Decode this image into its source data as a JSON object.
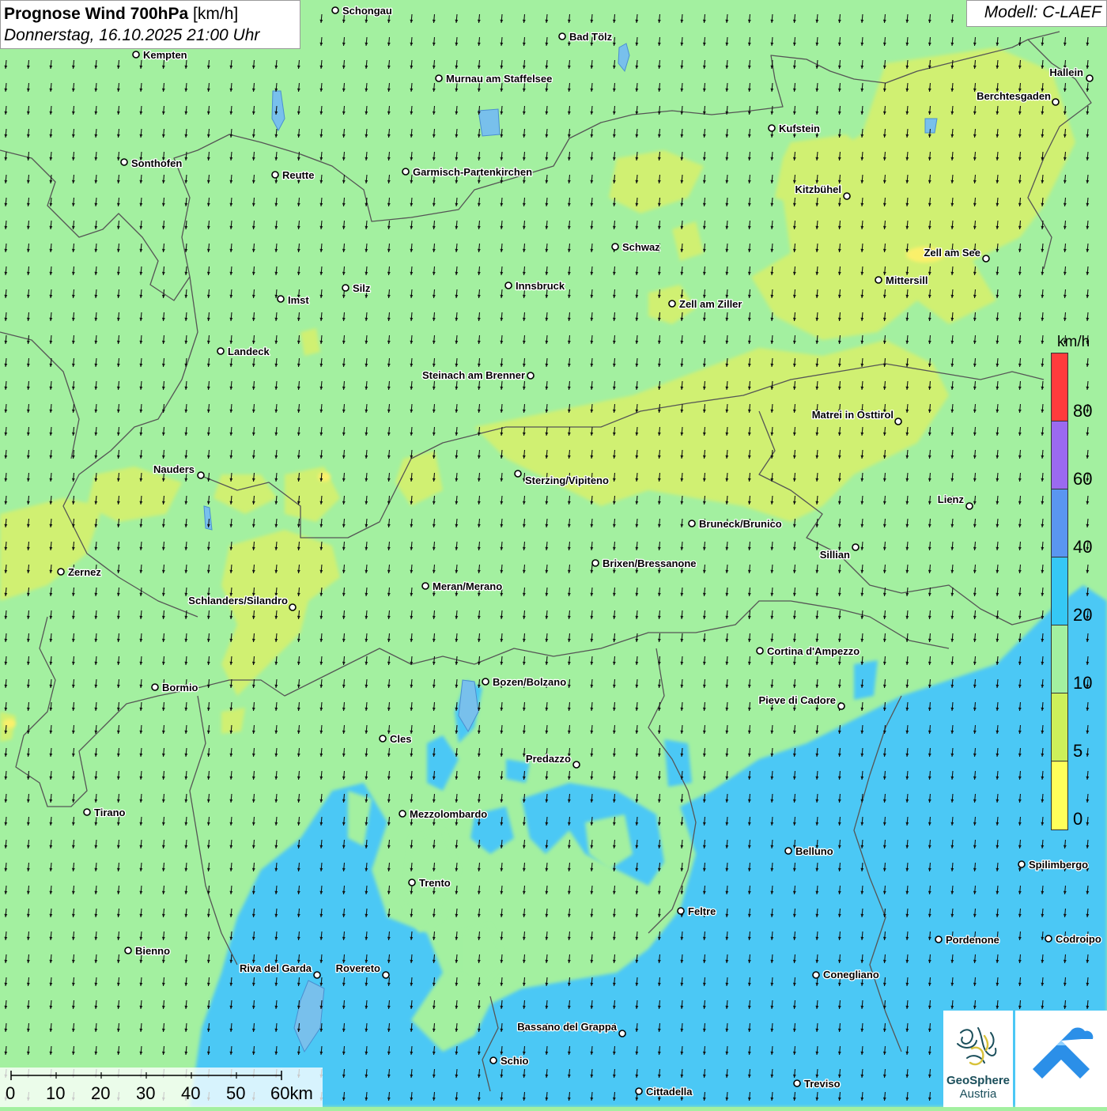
{
  "header": {
    "title": "Prognose Wind 700hPa",
    "unit": "[km/h]",
    "datetime": "Donnerstag, 16.10.2025 21:00 Uhr"
  },
  "model_label": "Modell: C-LAEF",
  "legend": {
    "unit": "km/h",
    "ticks": [
      "80",
      "60",
      "40",
      "20",
      "10",
      "5",
      "0"
    ],
    "classes": [
      {
        "from": 0,
        "to": 5,
        "color": "#ffff5a"
      },
      {
        "from": 5,
        "to": 10,
        "color": "#cdf05a"
      },
      {
        "from": 10,
        "to": 20,
        "color": "#a3f0a0"
      },
      {
        "from": 20,
        "to": 40,
        "color": "#35c8f5"
      },
      {
        "from": 40,
        "to": 60,
        "color": "#5a96f0"
      },
      {
        "from": 60,
        "to": 80,
        "color": "#9b6af0"
      },
      {
        "from": 80,
        "to": 100,
        "color": "#ff3c3c"
      }
    ]
  },
  "scalebar": {
    "labels": [
      "0",
      "10",
      "20",
      "30",
      "40",
      "50",
      "60km"
    ]
  },
  "logos": {
    "geosphere_name": "GeoSphere",
    "geosphere_sub": "Austria"
  },
  "wind": {
    "direction": "north-northeast",
    "arrow_pointing": "south-southwest",
    "dominant_class_km_h": "10-20",
    "strong_class_km_h": "20-40 (south-east)",
    "weak_class_km_h": "5-10 (north-east)"
  },
  "cities": [
    {
      "name": "Schongau"
    },
    {
      "name": "Bad Tölz"
    },
    {
      "name": "Kempten"
    },
    {
      "name": "Murnau am Staffelsee"
    },
    {
      "name": "Hallein"
    },
    {
      "name": "Berchtesgaden"
    },
    {
      "name": "Kufstein"
    },
    {
      "name": "Sonthofen"
    },
    {
      "name": "Reutte"
    },
    {
      "name": "Garmisch-Partenkirchen"
    },
    {
      "name": "Kitzbühel"
    },
    {
      "name": "Schwaz"
    },
    {
      "name": "Zell am See"
    },
    {
      "name": "Innsbruck"
    },
    {
      "name": "Silz"
    },
    {
      "name": "Imst"
    },
    {
      "name": "Mittersill"
    },
    {
      "name": "Zell am Ziller"
    },
    {
      "name": "Landeck"
    },
    {
      "name": "Steinach am Brenner"
    },
    {
      "name": "Matrei in Osttirol"
    },
    {
      "name": "Nauders"
    },
    {
      "name": "Sterzing/Vipiteno"
    },
    {
      "name": "Lienz"
    },
    {
      "name": "Bruneck/Brunico"
    },
    {
      "name": "Sillian"
    },
    {
      "name": "Zernez"
    },
    {
      "name": "Brixen/Bressanone"
    },
    {
      "name": "Meran/Merano"
    },
    {
      "name": "Schlanders/Silandro"
    },
    {
      "name": "Cortina d'Ampezzo"
    },
    {
      "name": "Bozen/Bolzano"
    },
    {
      "name": "Bormio"
    },
    {
      "name": "Pieve di Cadore"
    },
    {
      "name": "Cles"
    },
    {
      "name": "Predazzo"
    },
    {
      "name": "Tirano"
    },
    {
      "name": "Mezzolombardo"
    },
    {
      "name": "Belluno"
    },
    {
      "name": "Spilimbergo"
    },
    {
      "name": "Trento"
    },
    {
      "name": "Feltre"
    },
    {
      "name": "Pordenone"
    },
    {
      "name": "Codroipo"
    },
    {
      "name": "Bienno"
    },
    {
      "name": "Riva del Garda"
    },
    {
      "name": "Rovereto"
    },
    {
      "name": "Conegliano"
    },
    {
      "name": "Bassano del Grappa"
    },
    {
      "name": "Schio"
    },
    {
      "name": "Treviso"
    },
    {
      "name": "Cittadella"
    }
  ]
}
